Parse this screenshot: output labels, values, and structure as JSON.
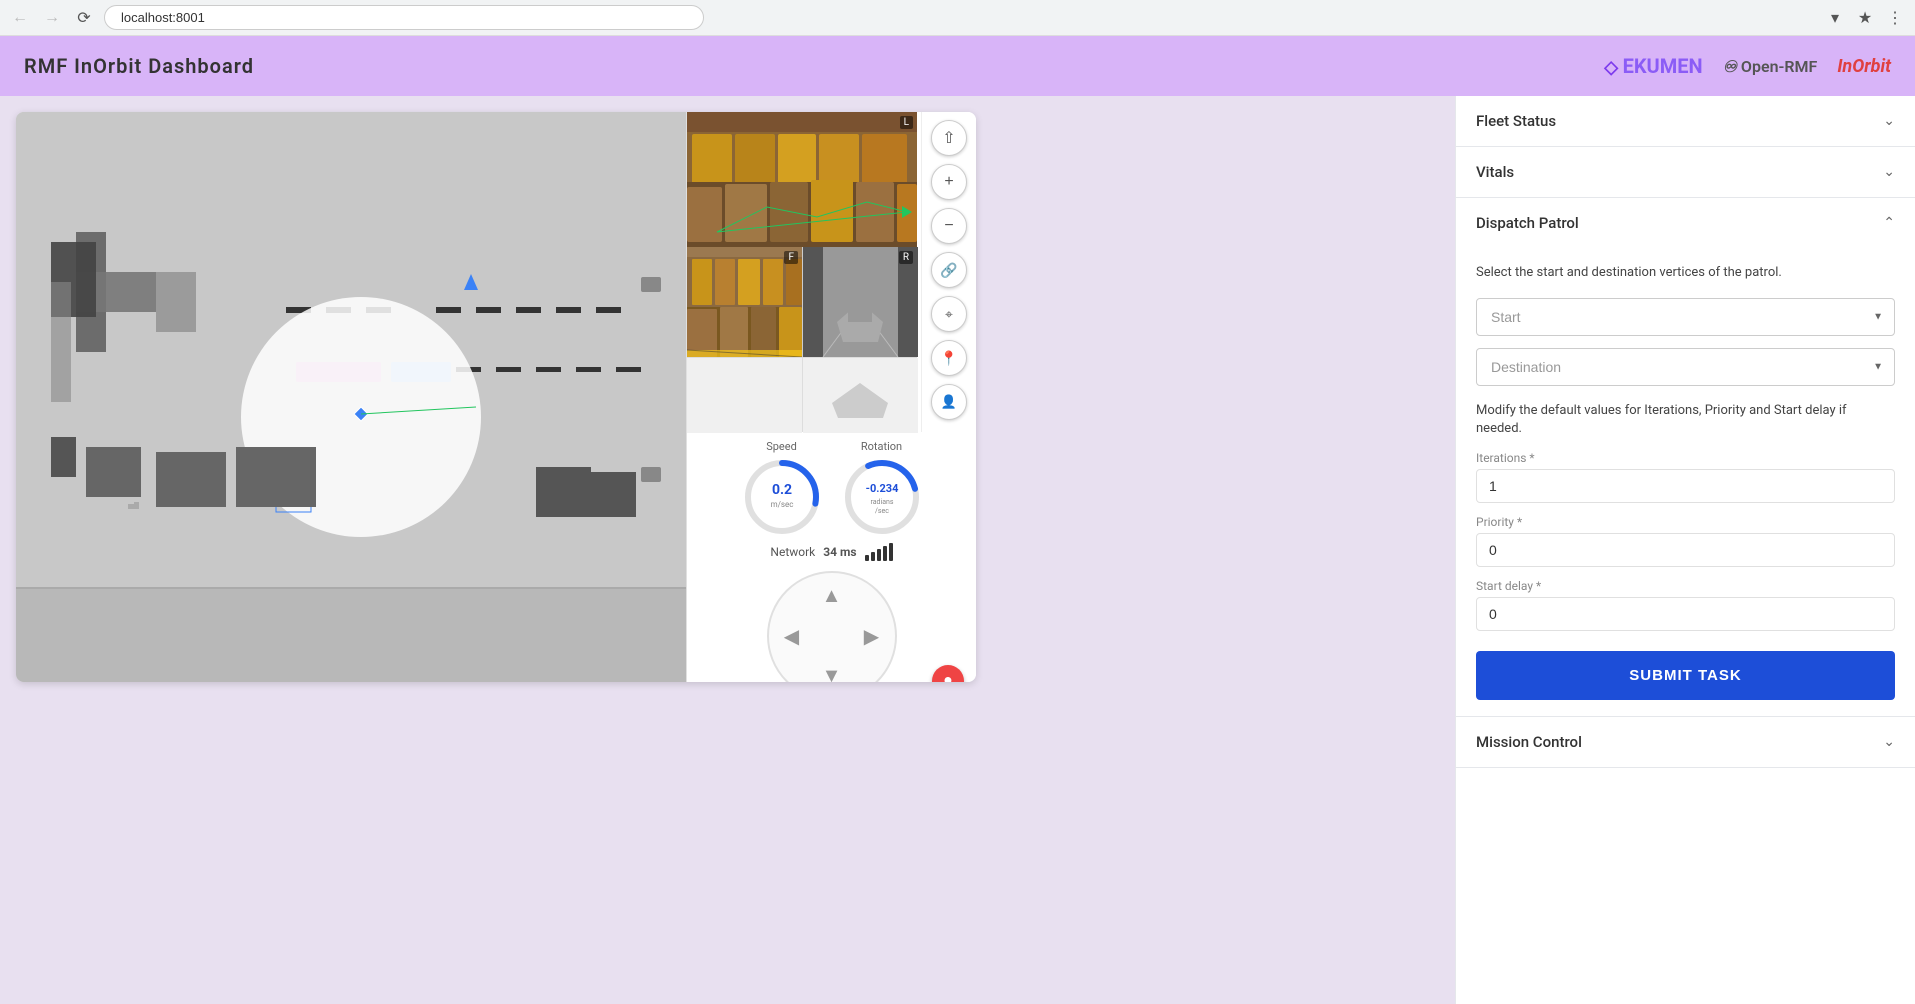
{
  "browser": {
    "url": "localhost:8001",
    "back_disabled": true,
    "forward_disabled": true
  },
  "header": {
    "title": "RMF InOrbit Dashboard",
    "logos": {
      "ekumen": "EKUMEN",
      "openrmf": "Open-RMF",
      "inorbit": "InOrbit"
    }
  },
  "sidebar": {
    "sections": [
      {
        "id": "fleet-status",
        "label": "Fleet Status",
        "expanded": false
      },
      {
        "id": "vitals",
        "label": "Vitals",
        "expanded": false
      },
      {
        "id": "dispatch-patrol",
        "label": "Dispatch Patrol",
        "expanded": true
      },
      {
        "id": "mission-control",
        "label": "Mission Control",
        "expanded": false
      }
    ]
  },
  "dispatch_patrol": {
    "instruction": "Select the start and destination vertices of the patrol.",
    "start_placeholder": "Start",
    "destination_placeholder": "Destination",
    "modify_label": "Modify the default values for Iterations, Priority and Start delay if needed.",
    "iterations_label": "Iterations *",
    "iterations_value": "1",
    "priority_label": "Priority *",
    "priority_value": "0",
    "start_delay_label": "Start delay *",
    "start_delay_value": "0",
    "submit_label": "SUBMIT TASK"
  },
  "robot": {
    "speed_label": "Speed",
    "speed_value": "0.2",
    "speed_unit": "m/sec",
    "rotation_label": "Rotation",
    "rotation_value": "-0.234",
    "rotation_unit": "radians/sec",
    "network_label": "Network",
    "network_ms": "34 ms"
  },
  "camera_labels": {
    "main": "L",
    "sub_left": "F",
    "sub_right": "R"
  },
  "map_controls": {
    "north": "↑",
    "zoom_in": "+",
    "zoom_out": "−",
    "link": "🔗",
    "target": "◎",
    "location": "📍",
    "user": "👤"
  }
}
